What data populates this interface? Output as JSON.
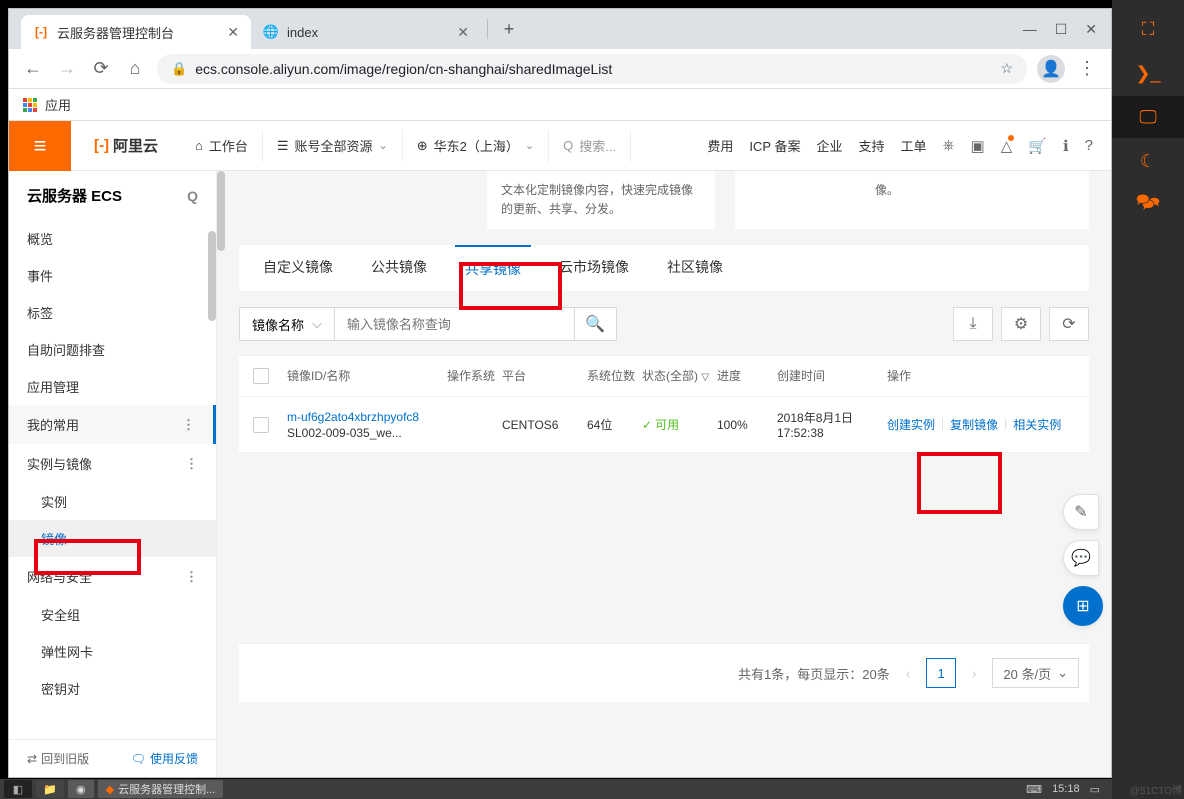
{
  "browser": {
    "tabs": [
      {
        "title": "云服务器管理控制台",
        "active": true
      },
      {
        "title": "index",
        "active": false
      }
    ],
    "url_display": "ecs.console.aliyun.com/image/region/cn-shanghai/sharedImageList",
    "bookmark_apps": "应用"
  },
  "aliyun_top": {
    "logo": "阿里云",
    "workbench": "工作台",
    "account_scope": "账号全部资源",
    "region": "华东2（上海）",
    "search_placeholder": "搜索...",
    "links": {
      "fee": "费用",
      "icp": "ICP 备案",
      "enterprise": "企业",
      "support": "支持",
      "ticket": "工单"
    }
  },
  "left_nav": {
    "title": "云服务器 ECS",
    "items_top": [
      "概览",
      "事件",
      "标签",
      "自助问题排查",
      "应用管理"
    ],
    "section_my": "我的常用",
    "section_instance": "实例与镜像",
    "sub_instance": [
      "实例",
      "镜像"
    ],
    "section_network": "网络与安全",
    "sub_network": [
      "安全组",
      "弹性网卡",
      "密钥对"
    ],
    "old_version": "回到旧版",
    "feedback": "使用反馈"
  },
  "content": {
    "left_card_text": "文本化定制镜像内容，快速完成镜像的更新、共享、分发。",
    "right_card_text": "像。",
    "tabs": [
      "自定义镜像",
      "公共镜像",
      "共享镜像",
      "云市场镜像",
      "社区镜像"
    ],
    "active_tab_index": 2,
    "filter_type": "镜像名称",
    "filter_placeholder": "输入镜像名称查询",
    "table_headers": {
      "id": "镜像ID/名称",
      "os": "操作系统",
      "platform": "平台",
      "bits": "系统位数",
      "status": "状态(全部)",
      "progress": "进度",
      "created": "创建时间",
      "actions": "操作"
    },
    "rows": [
      {
        "id_link": "m-uf6g2ato4xbrzhpyofc8",
        "name": "SL002-009-035_we...",
        "platform": "CENTOS6",
        "bits": "64位",
        "status": "可用",
        "progress": "100%",
        "created": "2018年8月1日 17:52:38",
        "actions": [
          "创建实例",
          "复制镜像",
          "相关实例"
        ]
      }
    ],
    "pagination": {
      "total_text": "共有1条，每页显示：20条",
      "page": "1",
      "size_label": "20 条/页"
    }
  },
  "taskbar": {
    "app": "云服务器管理控制...",
    "time": "15:18"
  },
  "watermark": "@51CTO博"
}
